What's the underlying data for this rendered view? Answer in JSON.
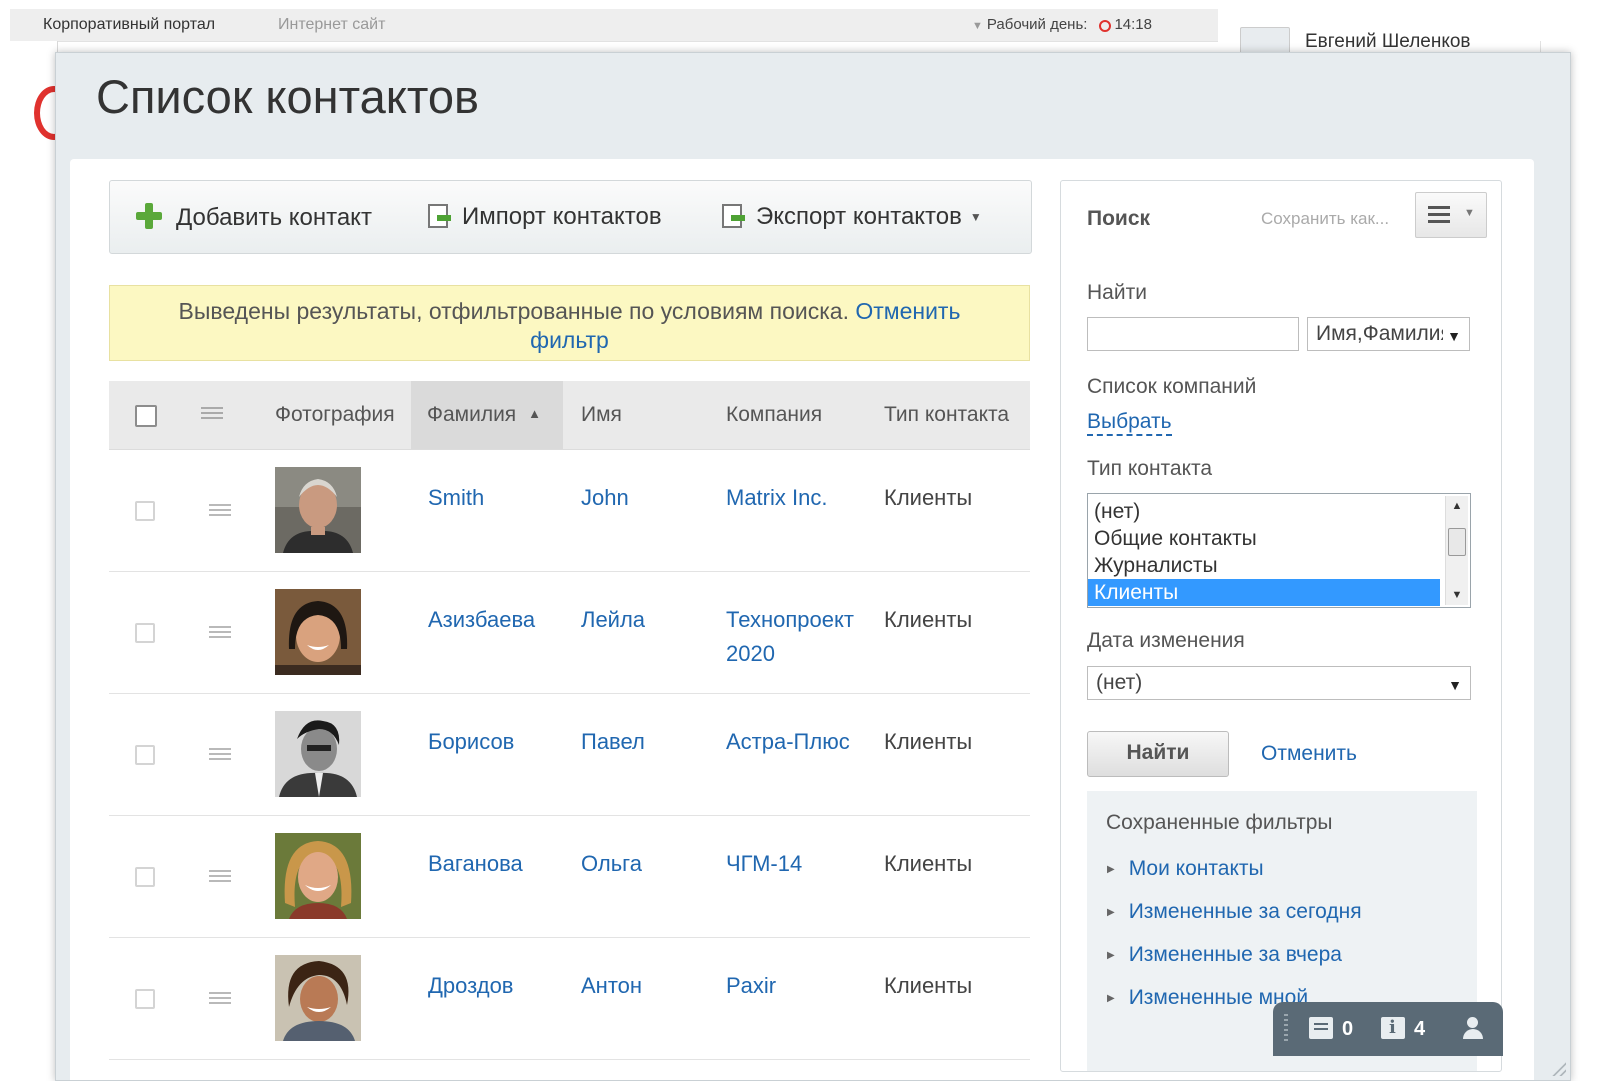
{
  "topbar": {
    "tab_portal": "Корпоративный портал",
    "tab_site": "Интернет сайт",
    "workday_label": "Рабочий день:",
    "time": "14:18"
  },
  "user": {
    "name": "Евгений Шеленков"
  },
  "dialog": {
    "title": "Список контактов",
    "toolbar": {
      "add": "Добавить контакт",
      "import": "Импорт контактов",
      "export": "Экспорт контактов"
    },
    "notice": {
      "text": "Выведены результаты, отфильтрованные по условиям поиска.",
      "link": "Отменить фильтр"
    },
    "grid": {
      "columns": {
        "photo": "Фотография",
        "lastname": "Фамилия",
        "firstname": "Имя",
        "company": "Компания",
        "type": "Тип контакта"
      },
      "rows": [
        {
          "lastname": "Smith",
          "firstname": "John",
          "company": "Matrix Inc.",
          "type": "Клиенты"
        },
        {
          "lastname": "Азизбаева",
          "firstname": "Лейла",
          "company": "Технопроект 2020",
          "type": "Клиенты"
        },
        {
          "lastname": "Борисов",
          "firstname": "Павел",
          "company": "Астра-Плюс",
          "type": "Клиенты"
        },
        {
          "lastname": "Ваганова",
          "firstname": "Ольга",
          "company": "ЧГМ-14",
          "type": "Клиенты"
        },
        {
          "lastname": "Дроздов",
          "firstname": "Антон",
          "company": "Paxir",
          "type": "Клиенты"
        }
      ]
    },
    "search": {
      "title": "Поиск",
      "save_as": "Сохранить как...",
      "find_label": "Найти",
      "find_value": "",
      "fields_select": "Имя,Фамилия",
      "companies_label": "Список компаний",
      "companies_link": "Выбрать",
      "type_label": "Тип контакта",
      "type_options": [
        "(нет)",
        "Общие контакты",
        "Журналисты",
        "Клиенты"
      ],
      "type_selected": "Клиенты",
      "date_label": "Дата изменения",
      "date_value": "(нет)",
      "find_button": "Найти",
      "cancel_button": "Отменить",
      "saved_title": "Сохраненные фильтры",
      "saved_filters": [
        "Мои контакты",
        "Измененные за сегодня",
        "Измененные за вчера",
        "Измененные мной"
      ]
    }
  },
  "counters": {
    "messages": "0",
    "notifications": "4"
  },
  "colors": {
    "link": "#2067b0",
    "accent_red": "#e0322e",
    "notice_bg": "#fcf8c2",
    "selected_option": "#3399ff"
  }
}
